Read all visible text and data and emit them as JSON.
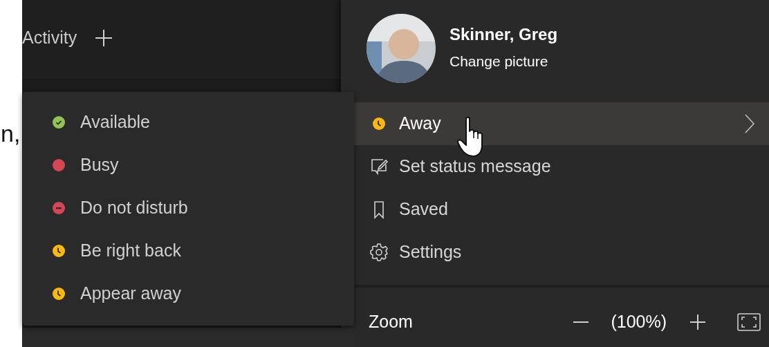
{
  "background_text": "n,",
  "app_bar": {
    "title": "Activity"
  },
  "status_menu": {
    "items": [
      {
        "label": "Available",
        "kind": "available",
        "color": "#92c353"
      },
      {
        "label": "Busy",
        "kind": "busy",
        "color": "#d74654"
      },
      {
        "label": "Do not disturb",
        "kind": "dnd",
        "color": "#d74654"
      },
      {
        "label": "Be right back",
        "kind": "away",
        "color": "#fcb80f"
      },
      {
        "label": "Appear away",
        "kind": "away",
        "color": "#fcb80f"
      }
    ]
  },
  "profile_menu": {
    "name": "Skinner, Greg",
    "change_picture": "Change picture",
    "items": [
      {
        "label": "Away",
        "kind": "status",
        "color": "#fcb80f",
        "selected": true,
        "submenu": true
      },
      {
        "label": "Set status message",
        "kind": "message",
        "selected": false,
        "submenu": false
      },
      {
        "label": "Saved",
        "kind": "saved",
        "selected": false,
        "submenu": false
      },
      {
        "label": "Settings",
        "kind": "settings",
        "selected": false,
        "submenu": false
      }
    ],
    "zoom": {
      "label": "Zoom",
      "value": "(100%)"
    }
  }
}
